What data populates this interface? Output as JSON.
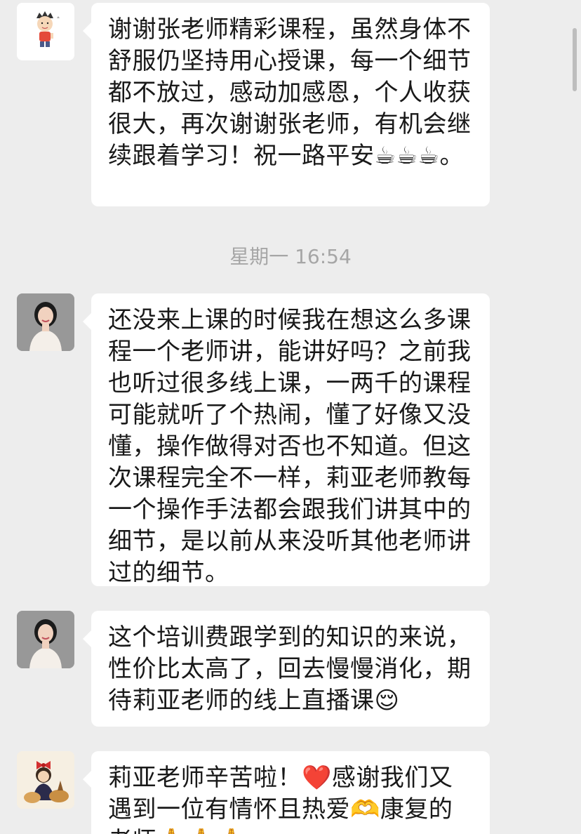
{
  "messages": [
    {
      "text": "谢谢张老师精彩课程，虽然身体不舒服仍坚持用心授课，每一个细节都不放过，感动加感恩，个人收获很大，再次谢谢张老师，有机会继续跟着学习！祝一路平安☕☕☕。",
      "avatar": "cartoon-boy-avatar"
    },
    {
      "text": "还没来上课的时候我在想这么多课程一个老师讲，能讲好吗？之前我也听过很多线上课，一两千的课程可能就听了个热闹，懂了好像又没懂，操作做得对否也不知道。但这次课程完全不一样，莉亚老师教每一个操作手法都会跟我们讲其中的细节，是以前从来没听其他老师讲过的细节。",
      "avatar": "woman-portrait-avatar"
    },
    {
      "text": "这个培训费跟学到的知识的来说，性价比太高了，回去慢慢消化，期待莉亚老师的线上直播课😌",
      "avatar": "woman-portrait-avatar"
    },
    {
      "text": "莉亚老师辛苦啦！❤️感谢我们又遇到一位有情怀且热爱🫶康复的老师🙏🙏🙏",
      "avatar": "cartoon-girl-avatar"
    }
  ],
  "timestamp": "星期一 16:54"
}
